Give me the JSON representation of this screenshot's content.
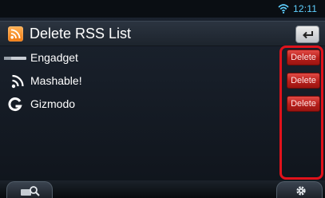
{
  "status_bar": {
    "time": "12:11",
    "wifi_icon": "wifi-icon"
  },
  "header": {
    "title": "Delete RSS List",
    "logo_icon": "rss-feed-icon",
    "back_icon": "back-arrow-icon"
  },
  "feeds": [
    {
      "name": "Engadget",
      "icon": "engadget-logo-icon",
      "delete_label": "Delete"
    },
    {
      "name": "Mashable!",
      "icon": "rss-feed-icon",
      "delete_label": "Delete"
    },
    {
      "name": "Gizmodo",
      "icon": "gizmodo-logo-icon",
      "delete_label": "Delete"
    }
  ],
  "bottom_bar": {
    "search_icon": "search-icon",
    "settings_icon": "gear-icon"
  },
  "colors": {
    "accent": "#5fd0ff",
    "delete": "#c4241f",
    "highlight": "#e0121b"
  }
}
